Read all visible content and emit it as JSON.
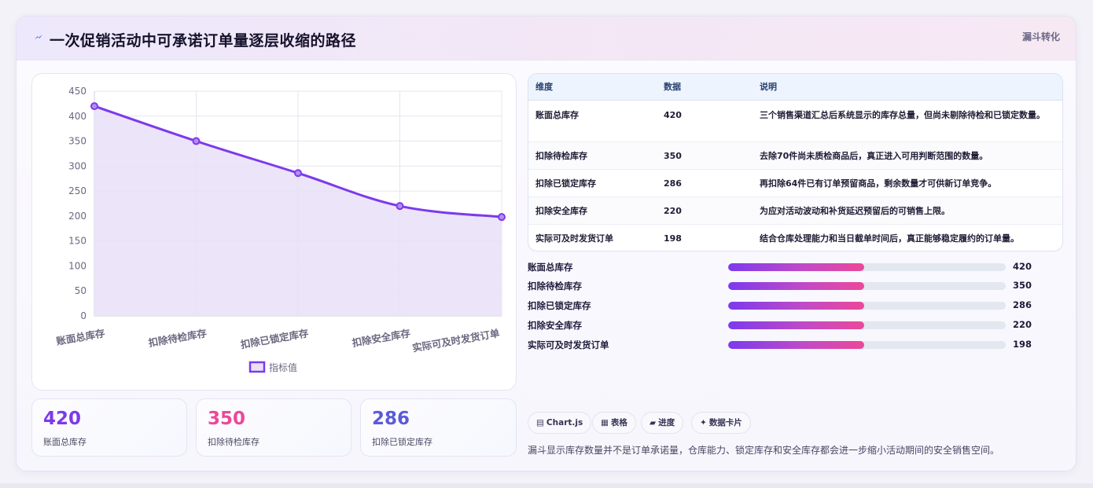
{
  "header": {
    "title": "一次促销活动中可承诺订单量逐层收缩的路径",
    "tag": "漏斗转化",
    "icon": "lightning-icon"
  },
  "chart_data": {
    "type": "line",
    "fill": true,
    "x": [
      "账面总库存",
      "扣除待检库存",
      "扣除已锁定库存",
      "扣除安全库存",
      "实际可及时发货订单"
    ],
    "series": [
      {
        "name": "指标值",
        "values": [
          420,
          350,
          286,
          220,
          198
        ]
      }
    ],
    "ylim": [
      0,
      450
    ],
    "yticks": [
      0,
      50,
      100,
      150,
      200,
      250,
      300,
      350,
      400,
      450
    ],
    "grid": true,
    "legend": "bottom",
    "color": "#7c3aed",
    "fill_color": "#e9e1f8"
  },
  "table": {
    "headers": [
      "维度",
      "数据",
      "说明"
    ],
    "rows": [
      {
        "dim": "账面总库存",
        "val": "420",
        "desc": "三个销售渠道汇总后系统显示的库存总量，但尚未剔除待检和已锁定数量。"
      },
      {
        "dim": "扣除待检库存",
        "val": "350",
        "desc": "去除70件尚未质检商品后，真正进入可用判断范围的数量。"
      },
      {
        "dim": "扣除已锁定库存",
        "val": "286",
        "desc": "再扣除64件已有订单预留商品，剩余数量才可供新订单竞争。"
      },
      {
        "dim": "扣除安全库存",
        "val": "220",
        "desc": "为应对活动波动和补货延迟预留后的可销售上限。"
      },
      {
        "dim": "实际可及时发货订单",
        "val": "198",
        "desc": "结合仓库处理能力和当日截单时间后，真正能够稳定履约的订单量。"
      }
    ]
  },
  "bars": [
    {
      "label": "账面总库存",
      "value": "420",
      "fill": 0.49
    },
    {
      "label": "扣除待检库存",
      "value": "350",
      "fill": 0.49
    },
    {
      "label": "扣除已锁定库存",
      "value": "286",
      "fill": 0.49
    },
    {
      "label": "扣除安全库存",
      "value": "220",
      "fill": 0.49
    },
    {
      "label": "实际可及时发货订单",
      "value": "198",
      "fill": 0.49
    }
  ],
  "stats": [
    {
      "value": "420",
      "label": "账面总库存",
      "color": "#7c3aed"
    },
    {
      "value": "350",
      "label": "扣除待检库存",
      "color": "#ec4899"
    },
    {
      "value": "286",
      "label": "扣除已锁定库存",
      "color": "#5b5bd6"
    }
  ],
  "chips": [
    {
      "icon": "▤",
      "label": "Chart.js"
    },
    {
      "icon": "▦",
      "label": "表格"
    },
    {
      "icon": "▰",
      "label": "进度"
    },
    {
      "icon": "✦",
      "label": "数据卡片"
    }
  ],
  "note": "漏斗显示库存数量并不是订单承诺量，仓库能力、锁定库存和安全库存都会进一步缩小活动期间的安全销售空间。"
}
